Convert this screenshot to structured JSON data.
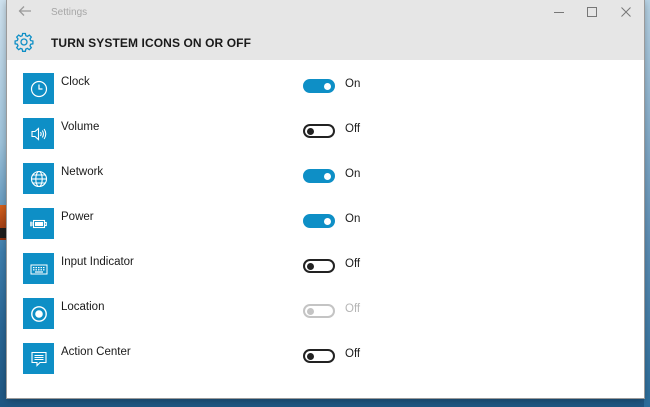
{
  "window": {
    "title": "Settings",
    "controls": [
      "minimize",
      "maximize",
      "close"
    ]
  },
  "header": {
    "title": "TURN SYSTEM ICONS ON OR OFF",
    "icon": "gear-icon"
  },
  "colors": {
    "accent": "#0e8fc6",
    "header_bg": "#e6e6e6"
  },
  "items": [
    {
      "label": "Clock",
      "icon": "clock-icon",
      "state": "On",
      "toggle": "on"
    },
    {
      "label": "Volume",
      "icon": "volume-icon",
      "state": "Off",
      "toggle": "off"
    },
    {
      "label": "Network",
      "icon": "globe-icon",
      "state": "On",
      "toggle": "on"
    },
    {
      "label": "Power",
      "icon": "battery-plug-icon",
      "state": "On",
      "toggle": "on"
    },
    {
      "label": "Input Indicator",
      "icon": "keyboard-icon",
      "state": "Off",
      "toggle": "off"
    },
    {
      "label": "Location",
      "icon": "location-icon",
      "state": "Off",
      "toggle": "disabled"
    },
    {
      "label": "Action Center",
      "icon": "action-center-icon",
      "state": "Off",
      "toggle": "off"
    }
  ]
}
